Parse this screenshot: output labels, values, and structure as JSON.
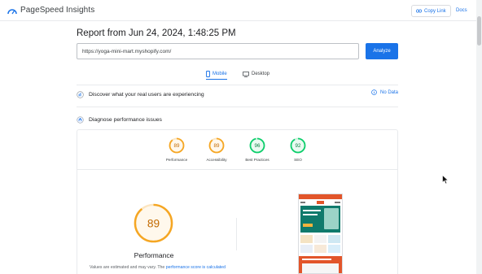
{
  "header": {
    "app_name": "PageSpeed Insights",
    "copy_link_label": "Copy Link",
    "docs_label": "Docs"
  },
  "report": {
    "title": "Report from Jun 24, 2024, 1:48:25 PM",
    "url_value": "https://yoga-mini-mart.myshopify.com/",
    "analyze_label": "Analyze"
  },
  "tabs": [
    {
      "label": "Mobile",
      "selected": true
    },
    {
      "label": "Desktop",
      "selected": false
    }
  ],
  "sections": {
    "discover": "Discover what your real users are experiencing",
    "no_data": "No Data",
    "diagnose": "Diagnose performance issues"
  },
  "scores": [
    {
      "label": "Performance",
      "value": "89",
      "color": "#f5a623"
    },
    {
      "label": "Accessibility",
      "value": "89",
      "color": "#f5a623"
    },
    {
      "label": "Best Practices",
      "value": "96",
      "color": "#0cce6b"
    },
    {
      "label": "SEO",
      "value": "92",
      "color": "#0cce6b"
    }
  ],
  "performance": {
    "score": "89",
    "title": "Performance",
    "note_prefix": "Values are estimated and may vary. The ",
    "note_link": "performance score is calculated"
  },
  "colors": {
    "accent": "#1a73e8",
    "average": "#f5a623",
    "pass": "#0cce6b"
  }
}
